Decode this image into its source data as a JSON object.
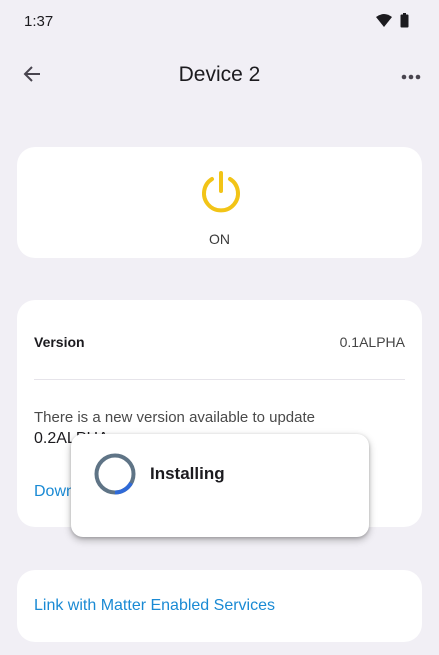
{
  "status_bar": {
    "time": "1:37",
    "icons": [
      "wifi-icon",
      "battery-icon"
    ]
  },
  "app_bar": {
    "title": "Device 2",
    "back_icon": "arrow-left-icon",
    "more_icon": "more-horizontal-icon"
  },
  "power": {
    "state_label": "ON",
    "icon": "power-icon",
    "color": "#f2c417"
  },
  "version": {
    "label": "Version",
    "current": "0.1ALPHA",
    "update_message": "There is a new version available to update",
    "new_version_partial": "0.2ALPHA",
    "download_label": "Download"
  },
  "dialog": {
    "text": "Installing",
    "spinner_color": "#5f7486",
    "spinner_accent": "#2f6ad8"
  },
  "matter": {
    "link_label": "Link with Matter Enabled Services"
  },
  "colors": {
    "background": "#f1eff5",
    "card": "#ffffff",
    "link": "#1a8ad4"
  }
}
